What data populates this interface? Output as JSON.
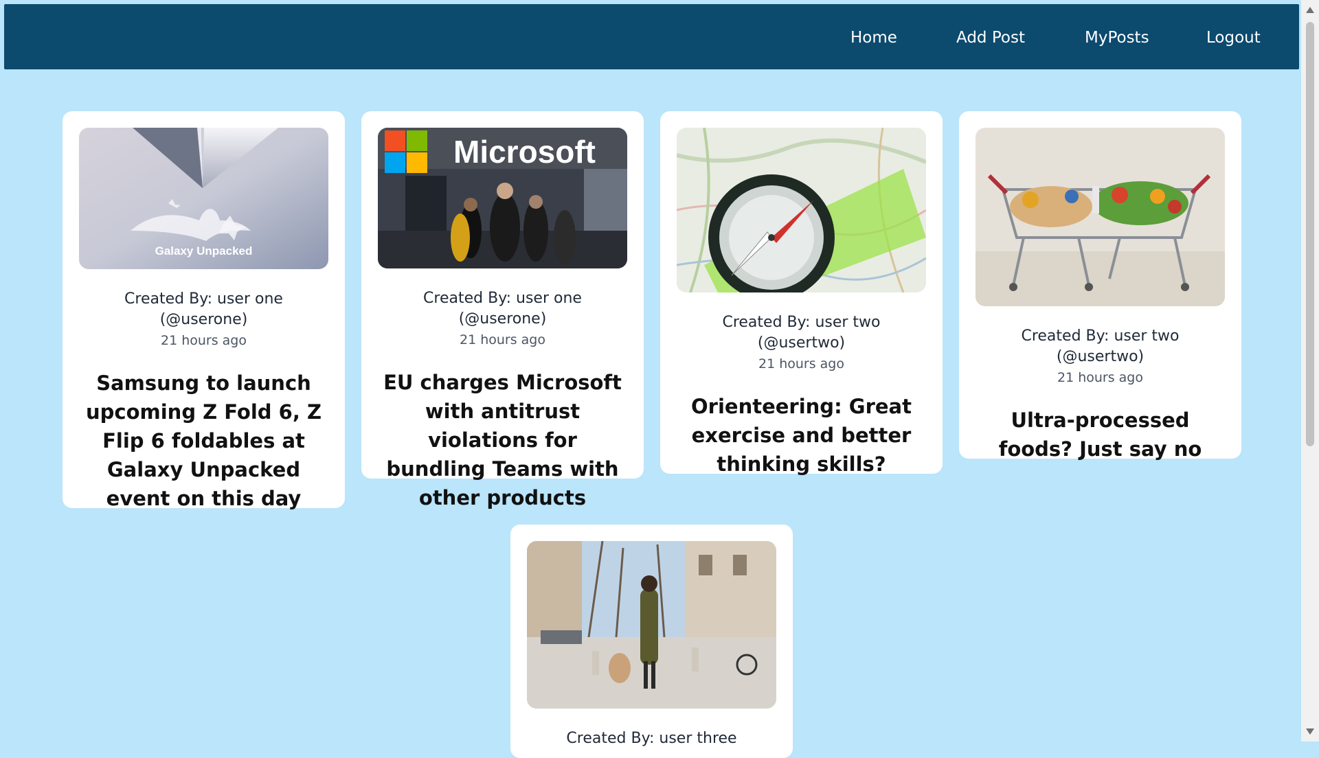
{
  "nav": {
    "items": [
      {
        "label": "Home"
      },
      {
        "label": "Add Post"
      },
      {
        "label": "MyPosts"
      },
      {
        "label": "Logout"
      }
    ]
  },
  "posts": [
    {
      "created_by": "Created By: user one (@userone)",
      "time": "21 hours ago",
      "title": "Samsung to launch upcoming Z Fold 6, Z Flip 6 foldables at Galaxy Unpacked event on this day",
      "image_text": "Galaxy Unpacked"
    },
    {
      "created_by": "Created By: user one (@userone)",
      "time": "21 hours ago",
      "title": "EU charges Microsoft with antitrust violations for bundling Teams with other products",
      "image_text": "Microsoft"
    },
    {
      "created_by": "Created By: user two (@usertwo)",
      "time": "21 hours ago",
      "title": "Orienteering: Great exercise and better thinking skills?"
    },
    {
      "created_by": "Created By: user two (@usertwo)",
      "time": "21 hours ago",
      "title": "Ultra-processed foods? Just say no"
    },
    {
      "created_by": "Created By: user three"
    }
  ],
  "colors": {
    "page_bg": "#bae5fb",
    "navbar_bg": "#0c4a6e",
    "card_bg": "#ffffff"
  }
}
